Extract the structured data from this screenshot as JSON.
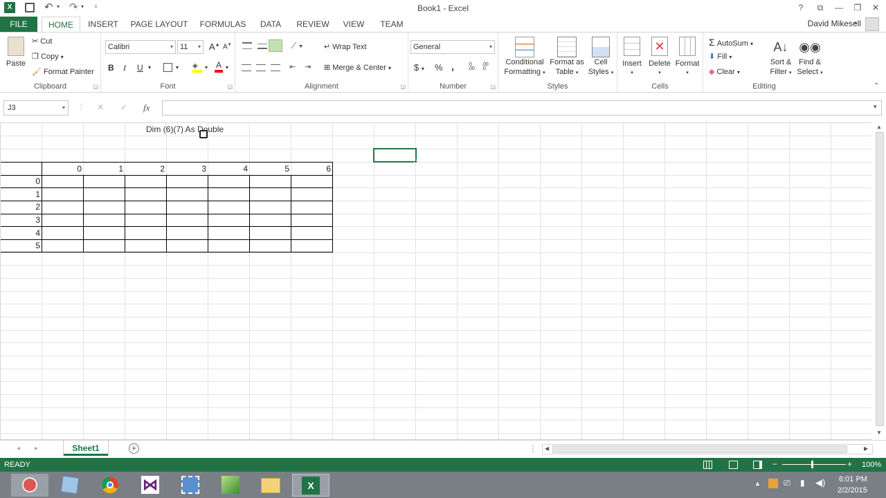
{
  "window": {
    "title": "Book1 - Excel",
    "help": "?",
    "restore": "⧉",
    "minimize": "—",
    "maximize": "❐",
    "close": "✕"
  },
  "tabs": [
    "FILE",
    "HOME",
    "INSERT",
    "PAGE LAYOUT",
    "FORMULAS",
    "DATA",
    "REVIEW",
    "VIEW",
    "TEAM"
  ],
  "user": "David Mikesell",
  "ribbon": {
    "clipboard": {
      "paste": "Paste",
      "cut": "Cut",
      "copy": "Copy",
      "format_painter": "Format Painter",
      "label": "Clipboard"
    },
    "font": {
      "name": "Calibri",
      "size": "11",
      "bold": "B",
      "italic": "I",
      "underline": "U",
      "label": "Font",
      "grow": "A",
      "shrink": "A"
    },
    "alignment": {
      "wrap": "Wrap Text",
      "merge": "Merge & Center",
      "label": "Alignment"
    },
    "number": {
      "format": "General",
      "currency": "$",
      "percent": "%",
      "comma": ",",
      "label": "Number",
      "inc": ".0 .00",
      "dec": ".00 .0"
    },
    "styles": {
      "cond1": "Conditional",
      "cond2": "Formatting",
      "fat1": "Format as",
      "fat2": "Table",
      "cs1": "Cell",
      "cs2": "Styles",
      "label": "Styles"
    },
    "cells": {
      "insert": "Insert",
      "delete": "Delete",
      "format": "Format",
      "label": "Cells"
    },
    "editing": {
      "autosum": "AutoSum",
      "fill": "Fill",
      "clear": "Clear",
      "sort1": "Sort &",
      "sort2": "Filter",
      "find1": "Find &",
      "find2": "Select",
      "label": "Editing"
    }
  },
  "formula_bar": {
    "name_box": "J3",
    "fx": "fx",
    "cancel": "✕",
    "enter": "✓",
    "value": ""
  },
  "sheet": {
    "heading": "Dim (6)(7) As Double",
    "col_headers": [
      "0",
      "1",
      "2",
      "3",
      "4",
      "5",
      "6"
    ],
    "row_headers": [
      "0",
      "1",
      "2",
      "3",
      "4",
      "5"
    ]
  },
  "sheet_tab": "Sheet1",
  "status": {
    "ready": "READY",
    "zoom": "100%"
  },
  "taskbar": {
    "time": "6:01 PM",
    "date": "2/2/2015"
  },
  "colors": {
    "excel_green": "#217346",
    "taskbar": "#7a7f86"
  }
}
